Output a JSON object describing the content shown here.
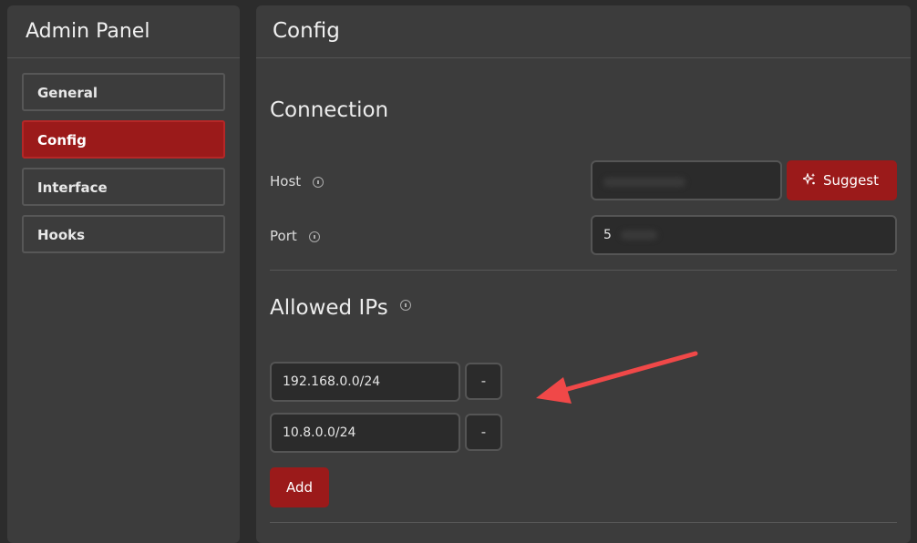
{
  "sidebar": {
    "title": "Admin Panel",
    "items": [
      {
        "label": "General",
        "active": false
      },
      {
        "label": "Config",
        "active": true
      },
      {
        "label": "Interface",
        "active": false
      },
      {
        "label": "Hooks",
        "active": false
      }
    ]
  },
  "main": {
    "title": "Config",
    "connection": {
      "title": "Connection",
      "host": {
        "label": "Host",
        "value": ""
      },
      "suggest_label": "Suggest",
      "port": {
        "label": "Port",
        "value": "5"
      }
    },
    "allowed_ips": {
      "title": "Allowed IPs",
      "entries": [
        "192.168.0.0/24",
        "10.8.0.0/24"
      ],
      "remove_label": "-",
      "add_label": "Add"
    }
  },
  "colors": {
    "accent": "#9b1a1a",
    "arrow": "#f04848"
  }
}
